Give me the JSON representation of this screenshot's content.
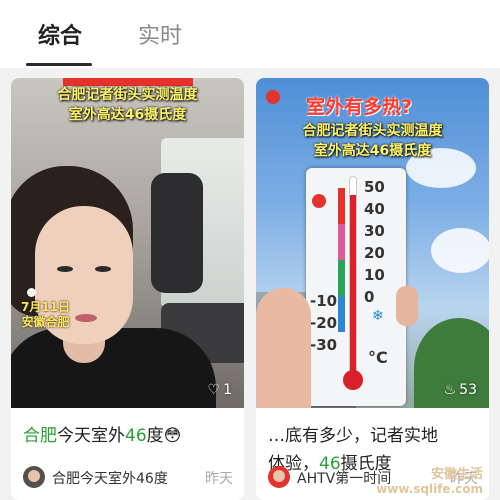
{
  "tabs": [
    {
      "label": "综合",
      "active": true
    },
    {
      "label": "实时",
      "active": false
    }
  ],
  "cards": [
    {
      "overlay_title_line1": "合肥记者街头实测温度",
      "overlay_title_line2": "室外高达46摄氏度",
      "overlay_date": "7月11日",
      "overlay_place": "安徽合肥",
      "likes": "1",
      "likes_icon": "heart-icon",
      "caption_parts": [
        {
          "text": "合肥",
          "highlight": true
        },
        {
          "text": "今天室外",
          "highlight": false
        },
        {
          "text": "46",
          "highlight": true
        },
        {
          "text": "度😳",
          "highlight": false
        }
      ],
      "author": "合肥今天室外46度",
      "time": "昨天"
    },
    {
      "overlay_title_main": "室外有多热?",
      "overlay_title_line1": "合肥记者街头实测温度",
      "overlay_title_line2": "室外高达46摄氏度",
      "thermometer": {
        "positive_labels": [
          "50",
          "40",
          "30",
          "20",
          "10",
          "0"
        ],
        "negative_labels": [
          "-10",
          "-20",
          "-30"
        ],
        "unit": "°C",
        "reading_celsius": 46
      },
      "likes": "53",
      "likes_icon": "fire-icon",
      "caption_line1": "…底有多少，记者实地",
      "caption_line2_plain": "体验，",
      "caption_line2_hl": "46",
      "caption_line2_rest": "摄氏度",
      "author": "AHTV第一时间",
      "time": "昨天"
    }
  ],
  "watermark": {
    "line1": "安徽生活",
    "line2": "www.sqlife.com"
  },
  "colors": {
    "accent_green": "#29a035",
    "thermo_red": "#d8212b",
    "title_yellow": "#fff36a"
  }
}
